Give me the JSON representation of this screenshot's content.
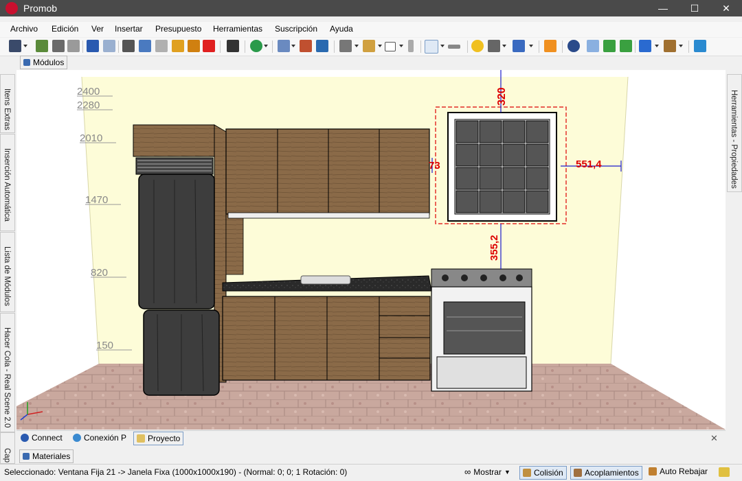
{
  "window": {
    "title": "Promob"
  },
  "menu": [
    "Archivo",
    "Edición",
    "Ver",
    "Insertar",
    "Presupuesto",
    "Herramientas",
    "Suscripción",
    "Ayuda"
  ],
  "top_tab": {
    "label": "Módulos"
  },
  "left_tabs": [
    "Itens Extras",
    "Inserción Automática",
    "Lista de Módulos",
    "Hacer Cola - Real Scene 2.0",
    "Cap"
  ],
  "right_tab": {
    "label": "Herramientas - Propiedades"
  },
  "ruler_labels": [
    "2400",
    "2280",
    "2010",
    "1470",
    "820",
    "150"
  ],
  "dimensions": {
    "top": "320",
    "left": "73",
    "right": "551,4",
    "bottom": "355,2"
  },
  "bottom_tabs": [
    "Connect",
    "Conexión P",
    "Proyecto"
  ],
  "materials_tab": {
    "label": "Materiales"
  },
  "status": {
    "text": "Seleccionado: Ventana Fija 21 -> Janela Fixa (1000x1000x190) - (Normal: 0; 0; 1 Rotación: 0)",
    "mostrar": "Mostrar",
    "colision": "Colisión",
    "acoplamientos": "Acoplamientos",
    "auto_rebajar": "Auto Rebajar"
  },
  "colors": {
    "titlebar": "#4a4a4a",
    "wall": "#fdfcd8",
    "dimension": "#dd0000",
    "dimension_line": "#1a1acc",
    "wood": "#8a6a48"
  }
}
